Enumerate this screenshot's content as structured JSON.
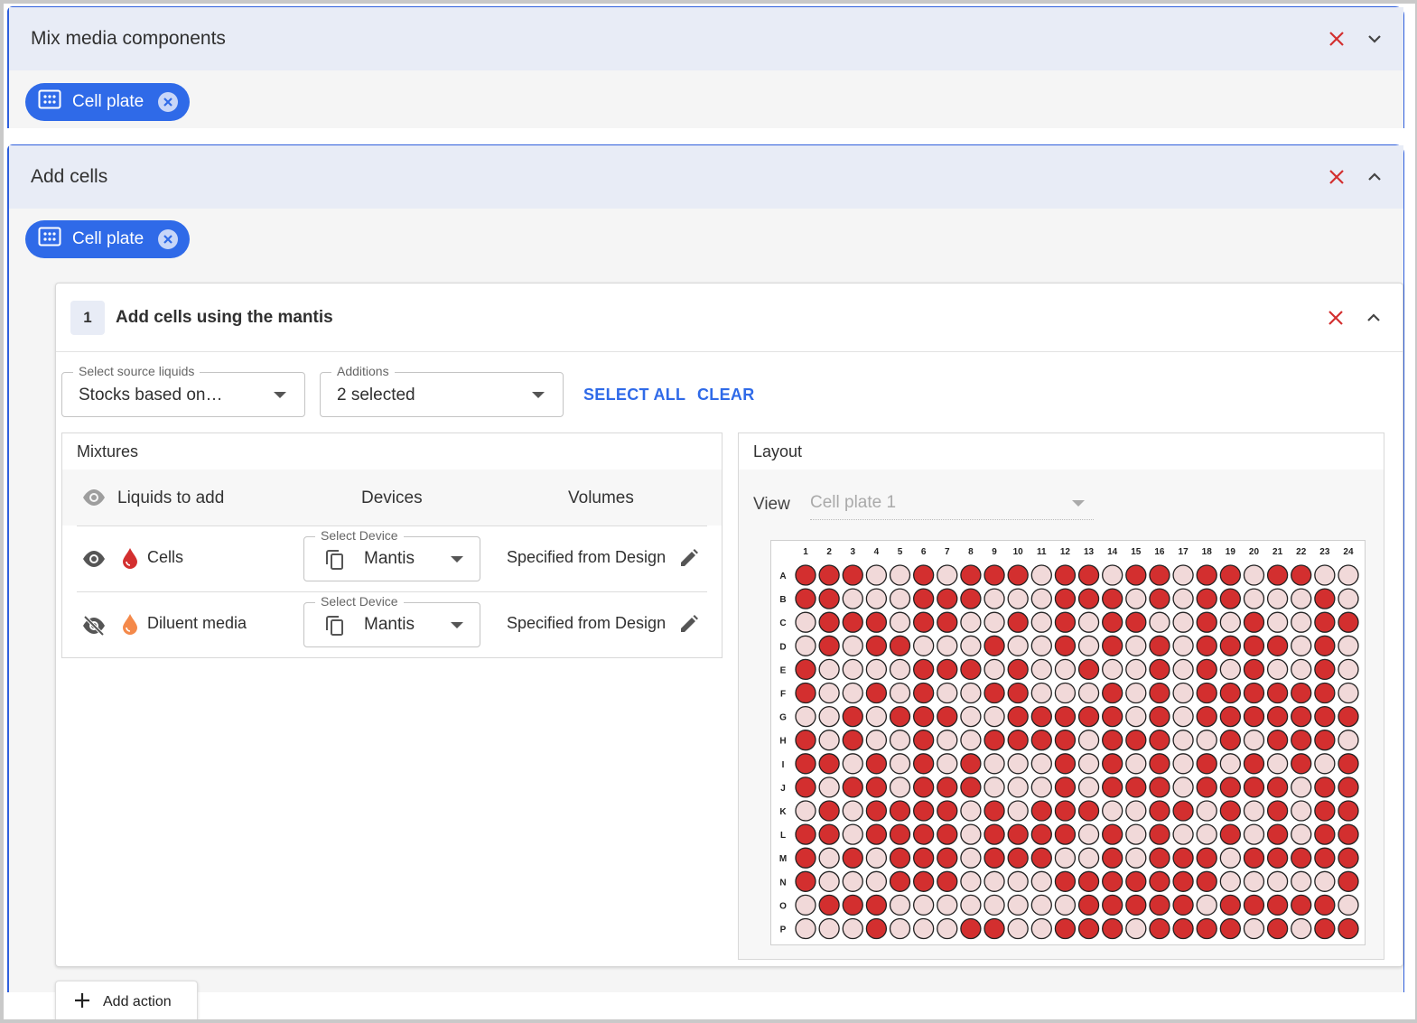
{
  "steps": [
    {
      "title": "Mix media components",
      "expanded": false,
      "chip_label": "Cell plate"
    },
    {
      "title": "Add cells",
      "expanded": true,
      "chip_label": "Cell plate"
    }
  ],
  "action": {
    "number": "1",
    "title": "Add cells using the mantis",
    "source_liquids": {
      "label": "Select source liquids",
      "value": "Stocks based on…"
    },
    "additions": {
      "label": "Additions",
      "value": "2 selected"
    },
    "select_all_label": "SELECT ALL",
    "clear_label": "CLEAR"
  },
  "mixtures": {
    "title": "Mixtures",
    "columns": {
      "liquids": "Liquids to add",
      "devices": "Devices",
      "volumes": "Volumes"
    },
    "rows": [
      {
        "name": "Cells",
        "visible": true,
        "drop_color": "#d32f2f",
        "device_label": "Select Device",
        "device": "Mantis",
        "volume": "Specified from Design"
      },
      {
        "name": "Diluent media",
        "visible": false,
        "drop_color": "#f4894a",
        "device_label": "Select Device",
        "device": "Mantis",
        "volume": "Specified from Design"
      }
    ]
  },
  "layout": {
    "title": "Layout",
    "view_label": "View",
    "view_value": "Cell plate 1",
    "columns": [
      "1",
      "2",
      "3",
      "4",
      "5",
      "6",
      "7",
      "8",
      "9",
      "10",
      "11",
      "12",
      "13",
      "14",
      "15",
      "16",
      "17",
      "18",
      "19",
      "20",
      "21",
      "22",
      "23",
      "24"
    ],
    "rows": [
      "A",
      "B",
      "C",
      "D",
      "E",
      "F",
      "G",
      "H",
      "I",
      "J",
      "K",
      "L",
      "M",
      "N",
      "O",
      "P"
    ],
    "wells": [
      "111001011101101101101100",
      "110001110001110101100010",
      "011101100101011001010011",
      "010110001001010101111010",
      "100001110100100101010010",
      "100101001100010101111110",
      "001011100111110101111111",
      "101001001111011100101110",
      "110101010001010101010101",
      "101101110001011101111011",
      "010111101011100110101011",
      "110111101111010100101011",
      "101011101110010111011111",
      "100011100001111111000001",
      "011100000000111110111110",
      "000100011001110111101011"
    ],
    "filled_color": "#d32f2f",
    "empty_color": "#f1d9d9"
  },
  "add_action_label": "Add action"
}
